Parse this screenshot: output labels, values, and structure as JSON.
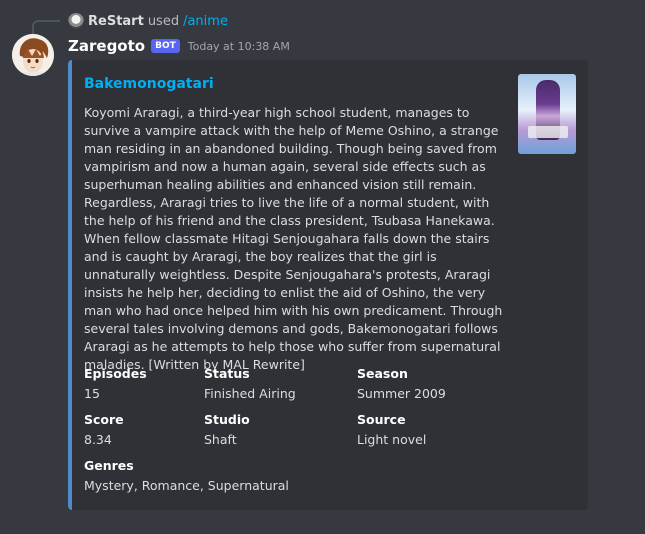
{
  "reply": {
    "user": "ReStart",
    "used_text": "used",
    "command": "/anime"
  },
  "message": {
    "username": "Zaregoto",
    "badge": "BOT",
    "timestamp": "Today at 10:38 AM"
  },
  "embed": {
    "accent_color": "#4f8bc9",
    "title": "Bakemonogatari",
    "description": "Koyomi Araragi, a third-year high school student, manages to survive a vampire attack with the help of Meme Oshino, a strange man residing in an abandoned building. Though being saved from vampirism and now a human again, several side effects such as superhuman healing abilities and enhanced vision still remain. Regardless, Araragi tries to live the life of a normal student, with the help of his friend and the class president, Tsubasa Hanekawa. When fellow classmate Hitagi Senjougahara falls down the stairs and is caught by Araragi, the boy realizes that the girl is unnaturally weightless. Despite Senjougahara's protests, Araragi insists he help her, deciding to enlist the aid of Oshino, the very man who had once helped him with his own predicament. Through several tales involving demons and gods, Bakemonogatari follows Araragi as he attempts to help those who suffer from supernatural maladies. [Written by MAL Rewrite]",
    "fields": {
      "episodes": {
        "name": "Episodes",
        "value": "15"
      },
      "status": {
        "name": "Status",
        "value": "Finished Airing"
      },
      "season": {
        "name": "Season",
        "value": "Summer 2009"
      },
      "score": {
        "name": "Score",
        "value": "8.34"
      },
      "studio": {
        "name": "Studio",
        "value": "Shaft"
      },
      "source": {
        "name": "Source",
        "value": "Light novel"
      },
      "genres": {
        "name": "Genres",
        "value": "Mystery, Romance, Supernatural"
      }
    }
  }
}
